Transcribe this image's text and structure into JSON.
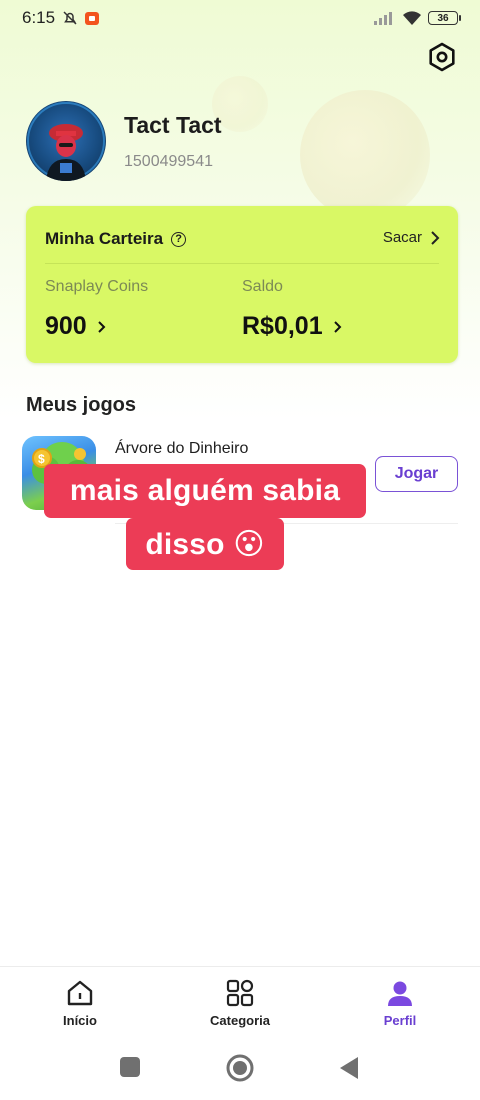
{
  "status_bar": {
    "time": "6:15",
    "battery": "36",
    "icons": [
      "bell-off-icon",
      "recording-icon",
      "signal-icon",
      "wifi-icon",
      "battery-icon"
    ]
  },
  "profile": {
    "name": "Tact Tact",
    "id": "1500499541"
  },
  "wallet": {
    "title": "Minha Carteira",
    "withdraw_label": "Sacar",
    "coins_label": "Snaplay Coins",
    "coins_value": "900",
    "balance_label": "Saldo",
    "balance_value": "R$0,01"
  },
  "games": {
    "section_title": "Meus jogos",
    "items": [
      {
        "name": "Árvore do Dinheiro",
        "action": "Jogar"
      }
    ]
  },
  "overlay_caption": {
    "line1": "mais alguém sabia",
    "line2": "disso 😮"
  },
  "bottom_nav": {
    "items": [
      {
        "label": "Início",
        "icon": "home-icon",
        "active": false
      },
      {
        "label": "Categoria",
        "icon": "grid-icon",
        "active": false
      },
      {
        "label": "Perfil",
        "icon": "person-icon",
        "active": true
      }
    ]
  },
  "colors": {
    "wallet_bg": "#d9f865",
    "accent": "#6a3fd1",
    "caption_bg": "#ec3c56"
  }
}
